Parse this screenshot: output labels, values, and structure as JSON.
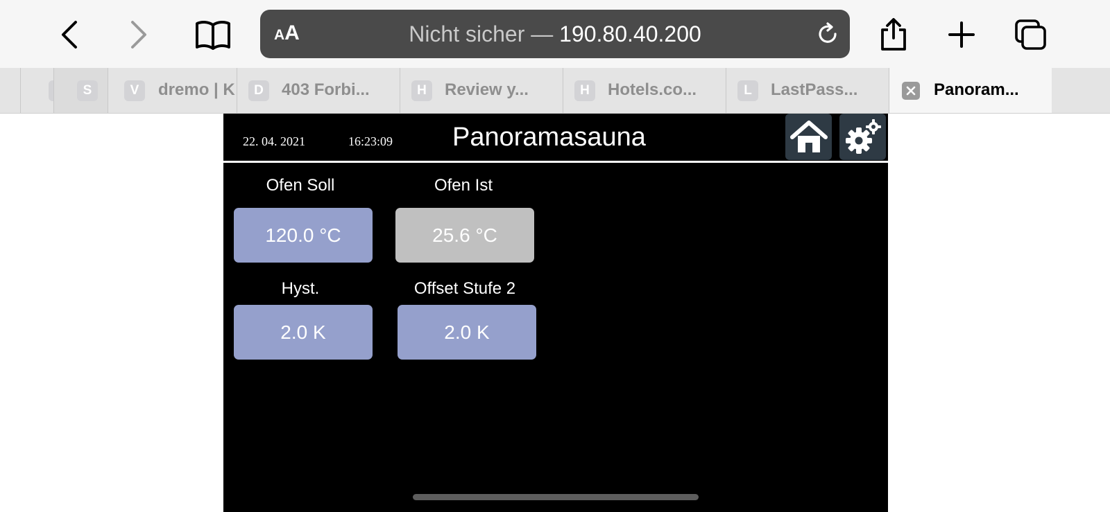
{
  "browser": {
    "address": {
      "text_size_label_small": "A",
      "text_size_label_large": "A",
      "security_label": "Nicht sicher —",
      "host": "190.80.40.200"
    },
    "tabs": [
      {
        "favicon": "",
        "title": ""
      },
      {
        "favicon": "S",
        "title": ""
      },
      {
        "favicon": "V",
        "title": "dremo | K"
      },
      {
        "favicon": "D",
        "title": "403 Forbi..."
      },
      {
        "favicon": "H",
        "title": "Review y..."
      },
      {
        "favicon": "H",
        "title": "Hotels.co..."
      },
      {
        "favicon": "L",
        "title": "LastPass..."
      },
      {
        "favicon": "",
        "title": "Panoram..."
      }
    ]
  },
  "panel": {
    "date": "22. 04. 2021",
    "time": "16:23:09",
    "title": "Panoramasauna",
    "fields": [
      {
        "label": "Ofen Soll",
        "value": "120.0 °C"
      },
      {
        "label": "Ofen Ist",
        "value": "25.6 °C"
      },
      {
        "label": "Hyst.",
        "value": "2.0 K"
      },
      {
        "label": "Offset Stufe 2",
        "value": "2.0 K"
      }
    ]
  },
  "colors": {
    "editable_field": "#95a0cc",
    "readonly_field": "#c0c0c0",
    "panel_background": "#000000"
  }
}
